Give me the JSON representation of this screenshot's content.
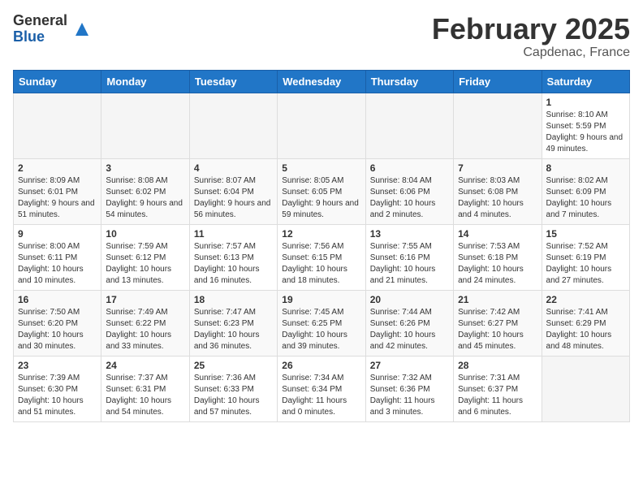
{
  "header": {
    "logo_general": "General",
    "logo_blue": "Blue",
    "month_title": "February 2025",
    "location": "Capdenac, France"
  },
  "calendar": {
    "days_of_week": [
      "Sunday",
      "Monday",
      "Tuesday",
      "Wednesday",
      "Thursday",
      "Friday",
      "Saturday"
    ],
    "weeks": [
      [
        {
          "day": "",
          "info": ""
        },
        {
          "day": "",
          "info": ""
        },
        {
          "day": "",
          "info": ""
        },
        {
          "day": "",
          "info": ""
        },
        {
          "day": "",
          "info": ""
        },
        {
          "day": "",
          "info": ""
        },
        {
          "day": "1",
          "info": "Sunrise: 8:10 AM\nSunset: 5:59 PM\nDaylight: 9 hours and 49 minutes."
        }
      ],
      [
        {
          "day": "2",
          "info": "Sunrise: 8:09 AM\nSunset: 6:01 PM\nDaylight: 9 hours and 51 minutes."
        },
        {
          "day": "3",
          "info": "Sunrise: 8:08 AM\nSunset: 6:02 PM\nDaylight: 9 hours and 54 minutes."
        },
        {
          "day": "4",
          "info": "Sunrise: 8:07 AM\nSunset: 6:04 PM\nDaylight: 9 hours and 56 minutes."
        },
        {
          "day": "5",
          "info": "Sunrise: 8:05 AM\nSunset: 6:05 PM\nDaylight: 9 hours and 59 minutes."
        },
        {
          "day": "6",
          "info": "Sunrise: 8:04 AM\nSunset: 6:06 PM\nDaylight: 10 hours and 2 minutes."
        },
        {
          "day": "7",
          "info": "Sunrise: 8:03 AM\nSunset: 6:08 PM\nDaylight: 10 hours and 4 minutes."
        },
        {
          "day": "8",
          "info": "Sunrise: 8:02 AM\nSunset: 6:09 PM\nDaylight: 10 hours and 7 minutes."
        }
      ],
      [
        {
          "day": "9",
          "info": "Sunrise: 8:00 AM\nSunset: 6:11 PM\nDaylight: 10 hours and 10 minutes."
        },
        {
          "day": "10",
          "info": "Sunrise: 7:59 AM\nSunset: 6:12 PM\nDaylight: 10 hours and 13 minutes."
        },
        {
          "day": "11",
          "info": "Sunrise: 7:57 AM\nSunset: 6:13 PM\nDaylight: 10 hours and 16 minutes."
        },
        {
          "day": "12",
          "info": "Sunrise: 7:56 AM\nSunset: 6:15 PM\nDaylight: 10 hours and 18 minutes."
        },
        {
          "day": "13",
          "info": "Sunrise: 7:55 AM\nSunset: 6:16 PM\nDaylight: 10 hours and 21 minutes."
        },
        {
          "day": "14",
          "info": "Sunrise: 7:53 AM\nSunset: 6:18 PM\nDaylight: 10 hours and 24 minutes."
        },
        {
          "day": "15",
          "info": "Sunrise: 7:52 AM\nSunset: 6:19 PM\nDaylight: 10 hours and 27 minutes."
        }
      ],
      [
        {
          "day": "16",
          "info": "Sunrise: 7:50 AM\nSunset: 6:20 PM\nDaylight: 10 hours and 30 minutes."
        },
        {
          "day": "17",
          "info": "Sunrise: 7:49 AM\nSunset: 6:22 PM\nDaylight: 10 hours and 33 minutes."
        },
        {
          "day": "18",
          "info": "Sunrise: 7:47 AM\nSunset: 6:23 PM\nDaylight: 10 hours and 36 minutes."
        },
        {
          "day": "19",
          "info": "Sunrise: 7:45 AM\nSunset: 6:25 PM\nDaylight: 10 hours and 39 minutes."
        },
        {
          "day": "20",
          "info": "Sunrise: 7:44 AM\nSunset: 6:26 PM\nDaylight: 10 hours and 42 minutes."
        },
        {
          "day": "21",
          "info": "Sunrise: 7:42 AM\nSunset: 6:27 PM\nDaylight: 10 hours and 45 minutes."
        },
        {
          "day": "22",
          "info": "Sunrise: 7:41 AM\nSunset: 6:29 PM\nDaylight: 10 hours and 48 minutes."
        }
      ],
      [
        {
          "day": "23",
          "info": "Sunrise: 7:39 AM\nSunset: 6:30 PM\nDaylight: 10 hours and 51 minutes."
        },
        {
          "day": "24",
          "info": "Sunrise: 7:37 AM\nSunset: 6:31 PM\nDaylight: 10 hours and 54 minutes."
        },
        {
          "day": "25",
          "info": "Sunrise: 7:36 AM\nSunset: 6:33 PM\nDaylight: 10 hours and 57 minutes."
        },
        {
          "day": "26",
          "info": "Sunrise: 7:34 AM\nSunset: 6:34 PM\nDaylight: 11 hours and 0 minutes."
        },
        {
          "day": "27",
          "info": "Sunrise: 7:32 AM\nSunset: 6:36 PM\nDaylight: 11 hours and 3 minutes."
        },
        {
          "day": "28",
          "info": "Sunrise: 7:31 AM\nSunset: 6:37 PM\nDaylight: 11 hours and 6 minutes."
        },
        {
          "day": "",
          "info": ""
        }
      ]
    ]
  }
}
